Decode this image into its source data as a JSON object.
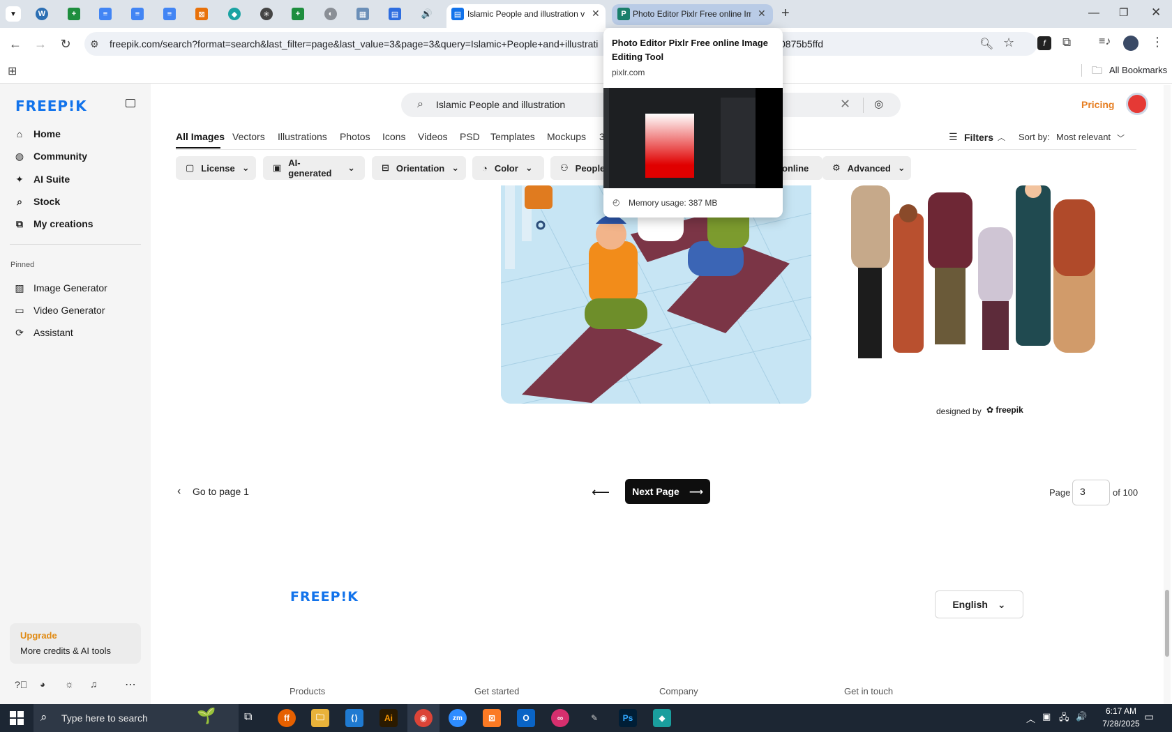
{
  "browser": {
    "tabs": [
      {
        "title": "Islamic People and illustration v",
        "active": true
      },
      {
        "title": "Photo Editor Pixlr Free online Im",
        "active": false,
        "hovered": true
      }
    ],
    "new_tab": "+",
    "url": "freepik.com/search?format=search&last_filter=page&last_value=3&page=3&query=Islamic+People+and+illustrati",
    "url_tail": "0875b5ffd",
    "bookmarks_label": "All Bookmarks"
  },
  "tab_preview": {
    "title": "Photo Editor Pixlr Free online Image Editing Tool",
    "domain": "pixlr.com",
    "memory": "Memory usage: 387 MB"
  },
  "sidebar": {
    "logo": "FREEP!K",
    "main_items": [
      {
        "label": "Home",
        "icon": "home-icon"
      },
      {
        "label": "Community",
        "icon": "globe-icon"
      },
      {
        "label": "AI Suite",
        "icon": "sparkle-icon"
      },
      {
        "label": "Stock",
        "icon": "search-icon"
      },
      {
        "label": "My creations",
        "icon": "creations-icon"
      }
    ],
    "pinned_heading": "Pinned",
    "pinned_items": [
      {
        "label": "Image Generator",
        "icon": "image-icon"
      },
      {
        "label": "Video Generator",
        "icon": "video-icon"
      },
      {
        "label": "Assistant",
        "icon": "assistant-icon"
      }
    ],
    "upgrade": {
      "title": "Upgrade",
      "subtitle": "More credits & AI tools"
    }
  },
  "search": {
    "query": "Islamic People and illustration"
  },
  "header": {
    "pricing": "Pricing"
  },
  "category_tabs": [
    "All Images",
    "Vectors",
    "Illustrations",
    "Photos",
    "Icons",
    "Videos",
    "PSD",
    "Templates",
    "Mockups",
    "3"
  ],
  "filters": {
    "filters_label": "Filters",
    "sort_label": "Sort by:",
    "sort_value": "Most relevant",
    "chips": [
      "License",
      "AI-generated",
      "Orientation",
      "Color",
      "People",
      "online",
      "Advanced"
    ]
  },
  "results": {
    "credit": "designed by",
    "credit_brand": "freepik"
  },
  "pagination": {
    "go_first": "Go to page 1",
    "next": "Next Page",
    "page_label": "Page",
    "page_value": "3",
    "of_label": "of 100"
  },
  "footer": {
    "logo": "FREEP!K",
    "language": "English",
    "columns": [
      "Products",
      "Get started",
      "Company",
      "Get in touch"
    ]
  },
  "taskbar": {
    "search_placeholder": "Type here to search",
    "time": "6:17 AM",
    "date": "7/28/2025"
  },
  "colors": {
    "brand_blue": "#1273eb",
    "pricing_orange": "#e67e22",
    "upgrade_orange": "#e08a13"
  }
}
